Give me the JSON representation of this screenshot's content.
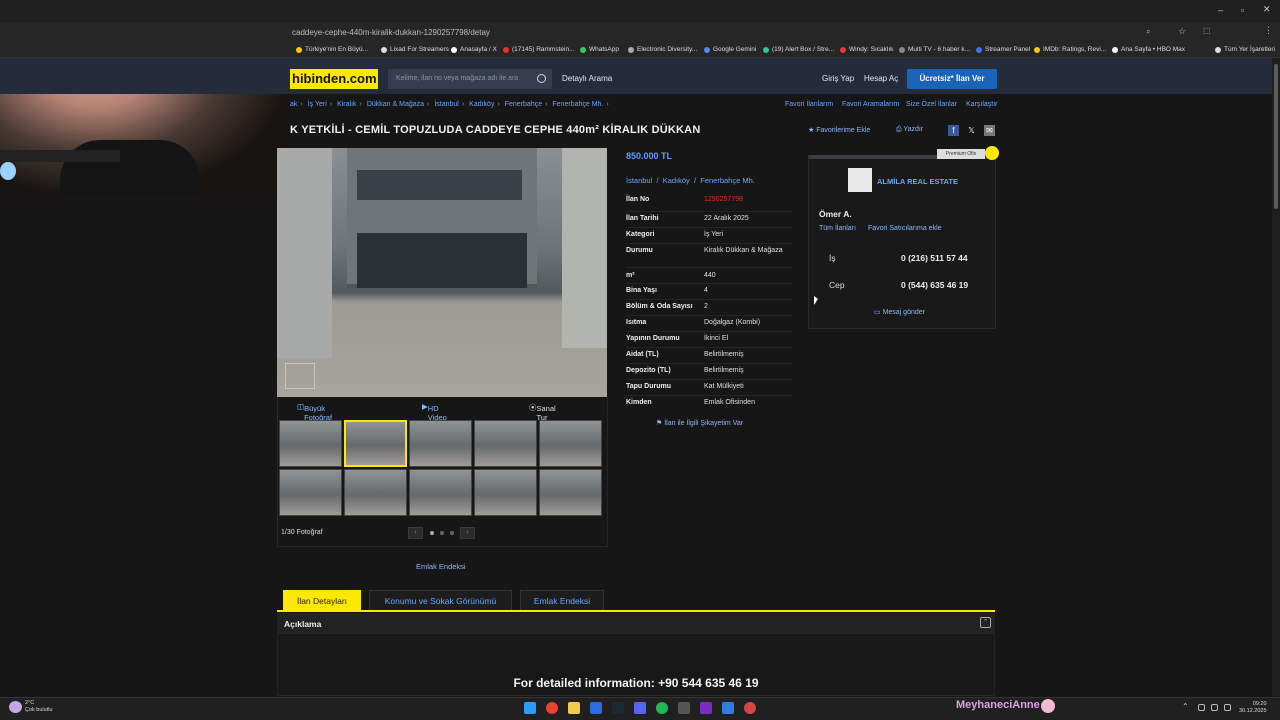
{
  "browser": {
    "url": "caddeye-cephe-440m-kiralik-dukkan-1290257798/detay",
    "bookmarks": [
      {
        "label": "Türkiye'nin En Büyü...",
        "color": "#ffcc00"
      },
      {
        "label": "Lixad For Streamers",
        "color": "#dddddd"
      },
      {
        "label": "Anasayfa / X",
        "color": "#ffffff"
      },
      {
        "label": "(17145) Rammstein...",
        "color": "#ff2a2a"
      },
      {
        "label": "WhatsApp",
        "color": "#25d366"
      },
      {
        "label": "Electronic Diversity...",
        "color": "#aaaaaa"
      },
      {
        "label": "Google Gemini",
        "color": "#4a8cff"
      },
      {
        "label": "(19) Alert Box / Stre...",
        "color": "#31c48d"
      },
      {
        "label": "Windy: Sıcaklık",
        "color": "#e63939"
      },
      {
        "label": "Multi TV - 6 haber k...",
        "color": "#888888"
      },
      {
        "label": "Streamer Panel",
        "color": "#4a6cff"
      },
      {
        "label": "IMDb: Ratings, Revi...",
        "color": "#f5c518"
      },
      {
        "label": "Ana Sayfa • HBO Max",
        "color": "#ffffff"
      },
      {
        "label": "Tüm Yer İşaretleri",
        "color": "#dddddd"
      }
    ]
  },
  "header": {
    "logo": "hibinden.com",
    "search_placeholder": "Kelime, ilan no veya mağaza adı ile ara",
    "detailed_search": "Detaylı Arama",
    "login": "Giriş Yap",
    "register": "Hesap Aç",
    "cta": "Ücretsiz* İlan Ver"
  },
  "breadcrumb": [
    "ak",
    "İş Yeri",
    "Kiralık",
    "Dükkan & Mağaza",
    "İstanbul",
    "Kadıköy",
    "Fenerbahçe",
    "Fenerbahçe Mh."
  ],
  "top_links": [
    "Favori İlanlarım",
    "Favori Aramalarım",
    "Size Özel İlanlar",
    "Karşılaştır"
  ],
  "listing": {
    "title": "K YETKİLİ - CEMİL TOPUZLUDA CADDEYE CEPHE 440m² KİRALIK DÜKKAN",
    "favorite": "Favorilerime Ekle",
    "print": "Yazdır",
    "price": "850.000 TL",
    "location": [
      "İstanbul",
      "Kadıköy",
      "Fenerbahçe Mh."
    ],
    "details": [
      {
        "k": "İlan No",
        "v": "1290257798"
      },
      {
        "k": "İlan Tarihi",
        "v": "22 Aralık 2025"
      },
      {
        "k": "Kategori",
        "v": "İş Yeri"
      },
      {
        "k": "Durumu",
        "v": "Kiralık Dükkan & Mağaza"
      },
      {
        "k": "m²",
        "v": "440"
      },
      {
        "k": "Bina Yaşı",
        "v": "4"
      },
      {
        "k": "Bölüm & Oda Sayısı",
        "v": "2"
      },
      {
        "k": "Isıtma",
        "v": "Doğalgaz (Kombi)"
      },
      {
        "k": "Yapının Durumu",
        "v": "İkinci El"
      },
      {
        "k": "Aidat (TL)",
        "v": "Belirtilmemiş"
      },
      {
        "k": "Depozito (TL)",
        "v": "Belirtilmemiş"
      },
      {
        "k": "Tapu Durumu",
        "v": "Kat Mülkiyeti"
      },
      {
        "k": "Kimden",
        "v": "Emlak Ofisinden"
      }
    ],
    "complaint": "İlan ile İlgili Şikayetim Var"
  },
  "media": {
    "big_photo": "Büyük Fotoğraf",
    "hd_video": "HD Video",
    "virtual_tour": "Sanal Tur",
    "photo_count": "1/30 Fotoğraf",
    "emlak_index": "Emlak Endeksi"
  },
  "seller": {
    "badge": "Premium Ofis",
    "agency": "ALMİLA REAL ESTATE",
    "agent": "Ömer A.",
    "all_listings": "Tüm İlanları",
    "favorite_seller": "Favori Satıcılarıma ekle",
    "phones": [
      {
        "label": "İş",
        "number": "0 (216) 511 57 44"
      },
      {
        "label": "Cep",
        "number": "0 (544) 635 46 19"
      }
    ],
    "send_message": "Mesaj gönder"
  },
  "tabs": [
    "İlan Detayları",
    "Konumu ve Sokak Görünümü",
    "Emlak Endeksi"
  ],
  "description": {
    "title": "Açıklama",
    "info": "For detailed information: +90 544 635 46 19"
  },
  "taskbar": {
    "weather_temp": "2°C",
    "weather_desc": "Çok bulutlu",
    "overlay_name": "MeyhaneciAnne",
    "time": "09:20",
    "date": "30.12.2025"
  }
}
